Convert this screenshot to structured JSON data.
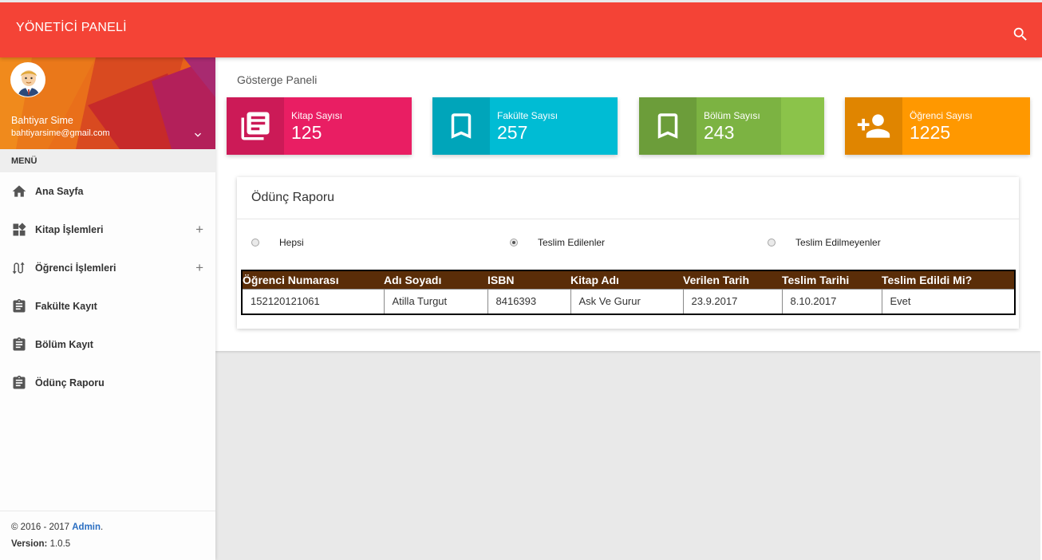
{
  "header": {
    "title": "YÖNETİCİ PANELİ",
    "search_icon": "search-icon"
  },
  "user": {
    "name": "Bahtiyar Sime",
    "email": "bahtiyarsime@gmail.com"
  },
  "menu": {
    "header": "MENÜ",
    "items": [
      {
        "label": "Ana Sayfa",
        "icon": "home-icon"
      },
      {
        "label": "Kitap İşlemleri",
        "icon": "widgets-icon",
        "expand": "+"
      },
      {
        "label": "Öğrenci İşlemleri",
        "icon": "swap-icon",
        "expand": "+"
      },
      {
        "label": "Fakülte Kayıt",
        "icon": "clipboard-icon"
      },
      {
        "label": "Bölüm Kayıt",
        "icon": "clipboard-icon"
      },
      {
        "label": "Ödünç Raporu",
        "icon": "clipboard-icon"
      }
    ]
  },
  "footer": {
    "copyright": "© 2016 - 2017 ",
    "link": "Admin",
    "period": ".",
    "version_label": "Version:",
    "version": " 1.0.5"
  },
  "page": {
    "title": "Gösterge Paneli"
  },
  "stats": [
    {
      "label": "Kitap Sayısı",
      "value": "125",
      "color": "#e91e63",
      "icon": "library-books-icon"
    },
    {
      "label": "Fakülte Sayısı",
      "value": "257",
      "color": "#00bcd4",
      "icon": "bookmark-icon"
    },
    {
      "label": "Bölüm Sayısı",
      "value": "243",
      "color": "#7cb342",
      "icon": "bookmark-icon"
    },
    {
      "label": "Öğrenci Sayısı",
      "value": "1225",
      "color": "#ff9800",
      "icon": "person-add-icon"
    }
  ],
  "report": {
    "title": "Ödünç Raporu",
    "filters": [
      {
        "label": "Hepsi",
        "checked": false
      },
      {
        "label": "Teslim Edilenler",
        "checked": true
      },
      {
        "label": "Teslim Edilmeyenler",
        "checked": false
      }
    ],
    "columns": [
      "Öğrenci Numarası",
      "Adı Soyadı",
      "ISBN",
      "Kitap Adı",
      "Verilen Tarih",
      "Teslim Tarihi",
      "Teslim Edildi Mi?"
    ],
    "rows": [
      [
        "152120121061",
        "Atilla Turgut",
        "8416393",
        "Ask Ve Gurur",
        "23.9.2017",
        "8.10.2017",
        "Evet"
      ]
    ]
  }
}
